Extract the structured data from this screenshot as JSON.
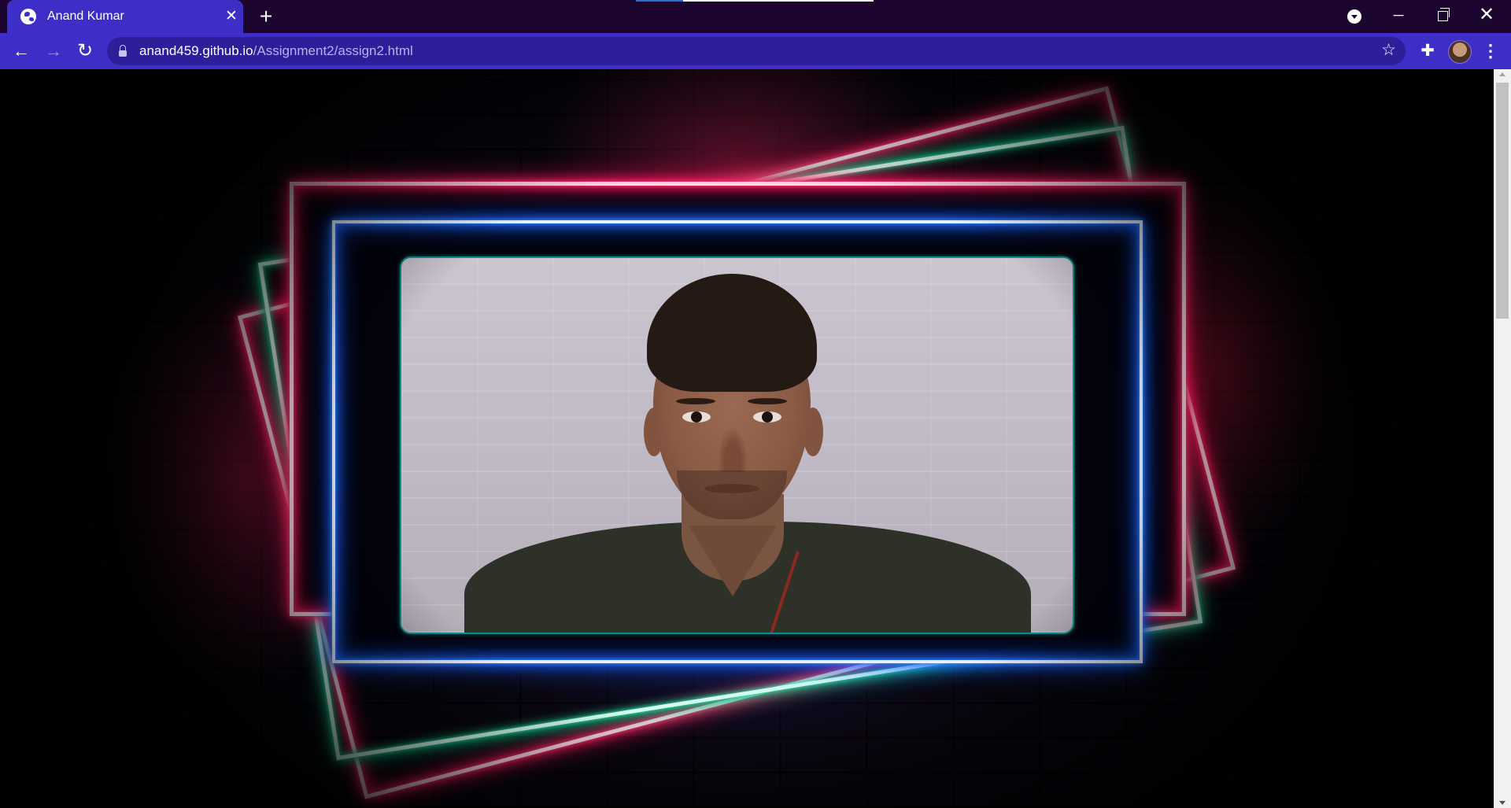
{
  "browser": {
    "tab": {
      "title": "Anand Kumar",
      "favicon": "globe-icon",
      "close_glyph": "✕"
    },
    "new_tab_glyph": "+",
    "window_controls": {
      "minimize": "─",
      "close": "✕"
    },
    "nav": {
      "back": "←",
      "forward": "→",
      "reload": "↻"
    },
    "address": {
      "host": "anand459.github.io",
      "path": "/Assignment2/assign2.html"
    },
    "bookmark_glyph": "☆",
    "extensions_glyph": "✚",
    "menu_glyph": "⋮"
  },
  "page": {
    "photo_subject": "portrait-photo",
    "colors": {
      "neon_pink": "#ff2266",
      "neon_green": "#11cc8d",
      "neon_blue": "#1f6dff",
      "chrome_accent": "#3d2ec7",
      "titlebar": "#1c0630"
    }
  }
}
